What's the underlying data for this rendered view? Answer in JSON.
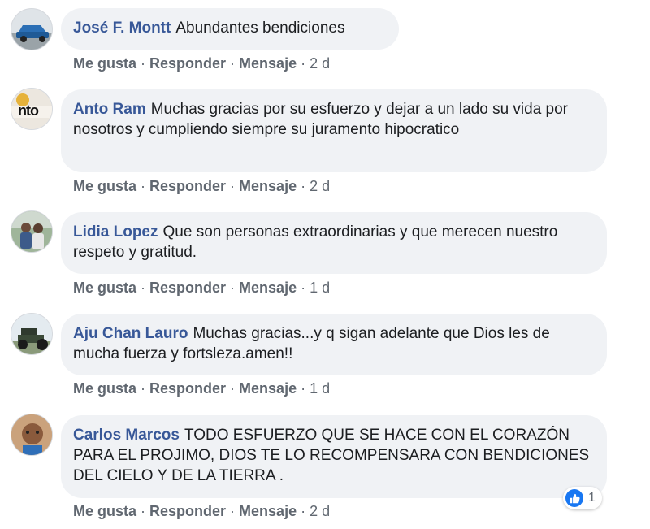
{
  "comments": [
    {
      "author": "José F. Montt",
      "text": "Abundantes bendiciones",
      "actions": {
        "like": "Me gusta",
        "reply": "Responder",
        "message": "Mensaje",
        "time": "2 d"
      }
    },
    {
      "author": "Anto Ram",
      "text": "Muchas gracias por su esfuerzo y dejar a un lado su vida por nosotros y cumpliendo siempre su juramento hipocratico",
      "actions": {
        "like": "Me gusta",
        "reply": "Responder",
        "message": "Mensaje",
        "time": "2 d"
      }
    },
    {
      "author": "Lidia Lopez",
      "text": "Que son personas extraordinarias y que merecen nuestro respeto y gratitud.",
      "actions": {
        "like": "Me gusta",
        "reply": "Responder",
        "message": "Mensaje",
        "time": "1 d"
      }
    },
    {
      "author": "Aju Chan Lauro",
      "text": "Muchas gracias...y q sigan adelante que Dios les de mucha fuerza y fortsleza.amen!!",
      "actions": {
        "like": "Me gusta",
        "reply": "Responder",
        "message": "Mensaje",
        "time": "1 d"
      }
    },
    {
      "author": "Carlos Marcos",
      "text": "TODO ESFUERZO QUE SE HACE CON EL CORAZÓN PARA EL PROJIMO, DIOS TE LO RECOMPENSARA CON BENDICIONES DEL CIELO Y DE LA TIERRA .",
      "actions": {
        "like": "Me gusta",
        "reply": "Responder",
        "message": "Mensaje",
        "time": "2 d"
      },
      "reaction": {
        "icon": "like-icon",
        "count": "1"
      }
    }
  ],
  "avatar_badges": {
    "anto": "nto"
  },
  "colors": {
    "author": "#385898",
    "bubble": "#f0f2f5",
    "meta": "#606770",
    "like": "#1877f2"
  }
}
